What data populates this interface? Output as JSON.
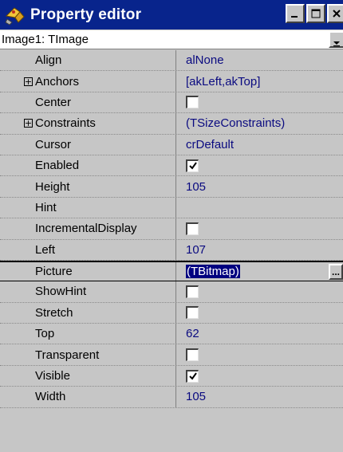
{
  "window": {
    "title": "Property editor",
    "buttons": {
      "minimize": "_",
      "maximize": "□",
      "close": "×"
    }
  },
  "object_selector": {
    "value": "Image1: TImage"
  },
  "properties": [
    {
      "name": "Align",
      "value": "alNone",
      "kind": "text"
    },
    {
      "name": "Anchors",
      "value": "[akLeft,akTop]",
      "kind": "text",
      "expandable": true
    },
    {
      "name": "Center",
      "value": "",
      "kind": "checkbox",
      "checked": false
    },
    {
      "name": "Constraints",
      "value": "(TSizeConstraints)",
      "kind": "text",
      "expandable": true
    },
    {
      "name": "Cursor",
      "value": "crDefault",
      "kind": "text"
    },
    {
      "name": "Enabled",
      "value": "",
      "kind": "checkbox",
      "checked": true
    },
    {
      "name": "Height",
      "value": "105",
      "kind": "text"
    },
    {
      "name": "Hint",
      "value": "",
      "kind": "text"
    },
    {
      "name": "IncrementalDisplay",
      "value": "",
      "kind": "checkbox",
      "checked": false
    },
    {
      "name": "Left",
      "value": "107",
      "kind": "text"
    },
    {
      "name": "Picture",
      "value": "(TBitmap)",
      "kind": "text",
      "selected": true,
      "ellipsis": "..."
    },
    {
      "name": "ShowHint",
      "value": "",
      "kind": "checkbox",
      "checked": false
    },
    {
      "name": "Stretch",
      "value": "",
      "kind": "checkbox",
      "checked": false
    },
    {
      "name": "Top",
      "value": "62",
      "kind": "text"
    },
    {
      "name": "Transparent",
      "value": "",
      "kind": "checkbox",
      "checked": false
    },
    {
      "name": "Visible",
      "value": "",
      "kind": "checkbox",
      "checked": true
    },
    {
      "name": "Width",
      "value": "105",
      "kind": "text"
    }
  ],
  "colors": {
    "title_bar": "#08248c",
    "value_text": "#0a0a80",
    "selection": "#000080",
    "panel": "#c6c6c6"
  }
}
